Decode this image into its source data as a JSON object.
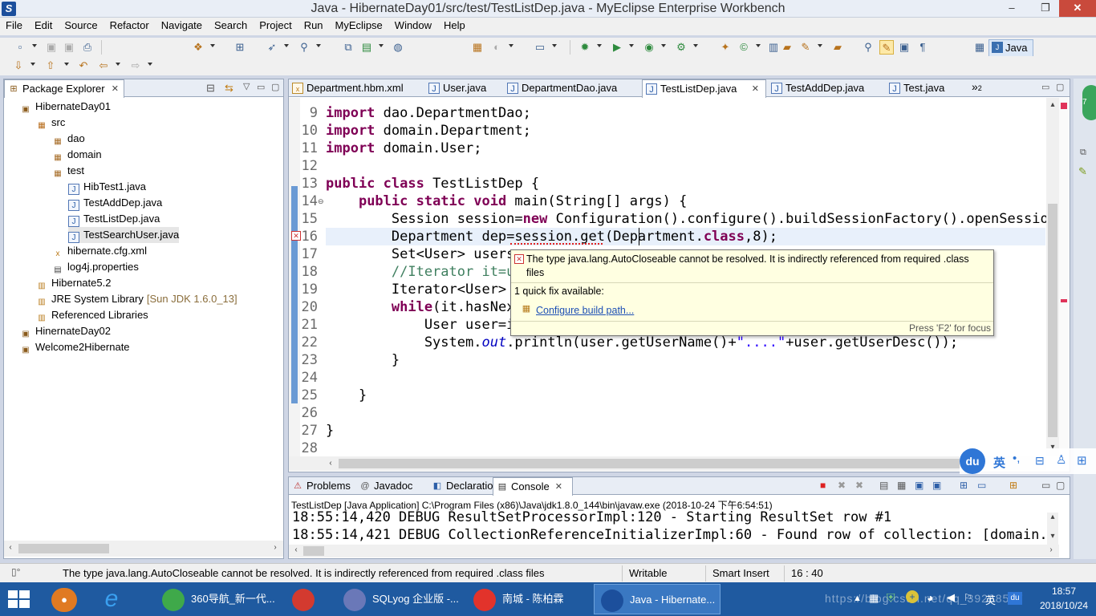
{
  "window": {
    "title": "Java - HibernateDay01/src/test/TestListDep.java - MyEclipse Enterprise Workbench",
    "min": "‒",
    "max": "❐",
    "close": "✕"
  },
  "menu": [
    "File",
    "Edit",
    "Source",
    "Refactor",
    "Navigate",
    "Search",
    "Project",
    "Run",
    "MyEclipse",
    "Window",
    "Help"
  ],
  "perspective": "Java",
  "explorer": {
    "title": "Package Explorer",
    "close": "✕",
    "rows": [
      {
        "label": "HibernateDay01",
        "icon": "project-icon"
      },
      {
        "label": "src",
        "icon": "source-folder-icon"
      },
      {
        "label": "dao",
        "icon": "package-icon"
      },
      {
        "label": "domain",
        "icon": "package-icon"
      },
      {
        "label": "test",
        "icon": "package-icon"
      },
      {
        "label": "HibTest1.java",
        "icon": "java-file-icon"
      },
      {
        "label": "TestAddDep.java",
        "icon": "java-file-icon"
      },
      {
        "label": "TestListDep.java",
        "icon": "java-file-icon"
      },
      {
        "label": "TestSearchUser.java",
        "icon": "java-file-icon"
      },
      {
        "label": "hibernate.cfg.xml",
        "icon": "xml-file-icon"
      },
      {
        "label": "log4j.properties",
        "icon": "properties-file-icon"
      },
      {
        "label": "Hibernate5.2",
        "icon": "library-icon"
      },
      {
        "label": "JRE System Library",
        "suffix": "[Sun JDK 1.6.0_13]",
        "icon": "library-icon"
      },
      {
        "label": "Referenced Libraries",
        "icon": "library-icon"
      },
      {
        "label": "HinernateDay02",
        "icon": "project-icon"
      },
      {
        "label": "Welcome2Hibernate",
        "icon": "project-icon"
      }
    ]
  },
  "editor": {
    "tabs": [
      {
        "label": "Department.hbm.xml",
        "icon": "xml-file-icon"
      },
      {
        "label": "User.java",
        "icon": "java-file-icon"
      },
      {
        "label": "DepartmentDao.java",
        "icon": "java-file-icon"
      },
      {
        "label": "TestListDep.java",
        "icon": "java-file-icon",
        "active": true
      },
      {
        "label": "TestAddDep.java",
        "icon": "java-file-icon"
      },
      {
        "label": "Test.java",
        "icon": "java-file-icon"
      }
    ],
    "overflow": "»",
    "overflow_count": "2",
    "tab_close": "✕",
    "lines": [
      {
        "n": "9",
        "parts": [
          [
            "kw",
            "import"
          ],
          [
            "t",
            " dao.DepartmentDao;"
          ]
        ]
      },
      {
        "n": "10",
        "parts": [
          [
            "kw",
            "import"
          ],
          [
            "t",
            " domain.Department;"
          ]
        ]
      },
      {
        "n": "11",
        "parts": [
          [
            "kw",
            "import"
          ],
          [
            "t",
            " domain.User;"
          ]
        ]
      },
      {
        "n": "12",
        "parts": []
      },
      {
        "n": "13",
        "parts": [
          [
            "kw",
            "public class"
          ],
          [
            "t",
            " TestListDep {"
          ]
        ]
      },
      {
        "n": "14",
        "parts": [
          [
            "t",
            "    "
          ],
          [
            "kw",
            "public static void"
          ],
          [
            "t",
            " main(String[] args) {"
          ]
        ]
      },
      {
        "n": "15",
        "parts": [
          [
            "t",
            "        Session session="
          ],
          [
            "kw",
            "new"
          ],
          [
            "t",
            " Configuration().configure().buildSessionFactory().openSession("
          ]
        ]
      },
      {
        "n": "16",
        "parts": [
          [
            "t",
            "        Department dep=session.get(Department."
          ],
          [
            "kw",
            "class"
          ],
          [
            "t",
            ",8);"
          ]
        ]
      },
      {
        "n": "17",
        "parts": [
          [
            "t",
            "        Set<User> users"
          ]
        ]
      },
      {
        "n": "18",
        "parts": [
          [
            "cm",
            "        //Iterator it=u"
          ]
        ]
      },
      {
        "n": "19",
        "parts": [
          [
            "t",
            "        Iterator<User> "
          ]
        ]
      },
      {
        "n": "20",
        "parts": [
          [
            "t",
            "        "
          ],
          [
            "kw",
            "while"
          ],
          [
            "t",
            "(it.hasNex"
          ]
        ]
      },
      {
        "n": "21",
        "parts": [
          [
            "t",
            "            User user=i"
          ]
        ]
      },
      {
        "n": "22",
        "parts": [
          [
            "t",
            "            System."
          ],
          [
            "fi",
            "out"
          ],
          [
            "t",
            ".println(user.getUserName()+"
          ],
          [
            "st",
            "\"....\""
          ],
          [
            "t",
            "+user.getUserDesc());"
          ]
        ]
      },
      {
        "n": "23",
        "parts": [
          [
            "t",
            "        }"
          ]
        ]
      },
      {
        "n": "24",
        "parts": []
      },
      {
        "n": "25",
        "parts": [
          [
            "t",
            "    }"
          ]
        ]
      },
      {
        "n": "26",
        "parts": []
      },
      {
        "n": "27",
        "parts": [
          [
            "t",
            "}"
          ]
        ]
      },
      {
        "n": "28",
        "parts": []
      }
    ]
  },
  "tooltip": {
    "message": "The type java.lang.AutoCloseable cannot be resolved. It is indirectly referenced from required .class files",
    "quickfix_header": "1 quick fix available:",
    "quickfix_link": "Configure build path...",
    "footer": "Press 'F2' for focus"
  },
  "console": {
    "tabs": [
      "Problems",
      "Javadoc",
      "Declaration",
      "Console"
    ],
    "close": "✕",
    "launch": "TestListDep [Java Application] C:\\Program Files (x86)\\Java\\jdk1.8.0_144\\bin\\javaw.exe (2018-10-24 下午6:54:51)",
    "lines": [
      "18:55:14,420 DEBUG ResultSetProcessorImpl:120 - Starting ResultSet row #1",
      "18:55:14,421 DEBUG CollectionReferenceInitializerImpl:60 - Found row of collection: [domain.Dep"
    ]
  },
  "status": {
    "message": "The type java.lang.AutoCloseable cannot be resolved. It is indirectly referenced from required .class files",
    "mode": "Writable",
    "insert": "Smart Insert",
    "position": "16 : 40"
  },
  "ime": {
    "logo": "du",
    "lang": "英"
  },
  "taskbar": {
    "items": [
      {
        "label": "360导航_新一代...",
        "color": "#3fa94a"
      },
      {
        "label": "",
        "color": "#d33a2f"
      },
      {
        "label": "SQLyog 企业版 -...",
        "color": "#6a78b8"
      },
      {
        "label": "南城 - 陈柏霖",
        "color": "#e2332b"
      },
      {
        "label": "Java - Hibernate...",
        "color": "#1c4f9c",
        "active": true
      }
    ],
    "tray_lang": "英",
    "time": "18:57",
    "date": "2018/10/24",
    "watermark": "https://blog.csdn.net/qq_39288537"
  }
}
